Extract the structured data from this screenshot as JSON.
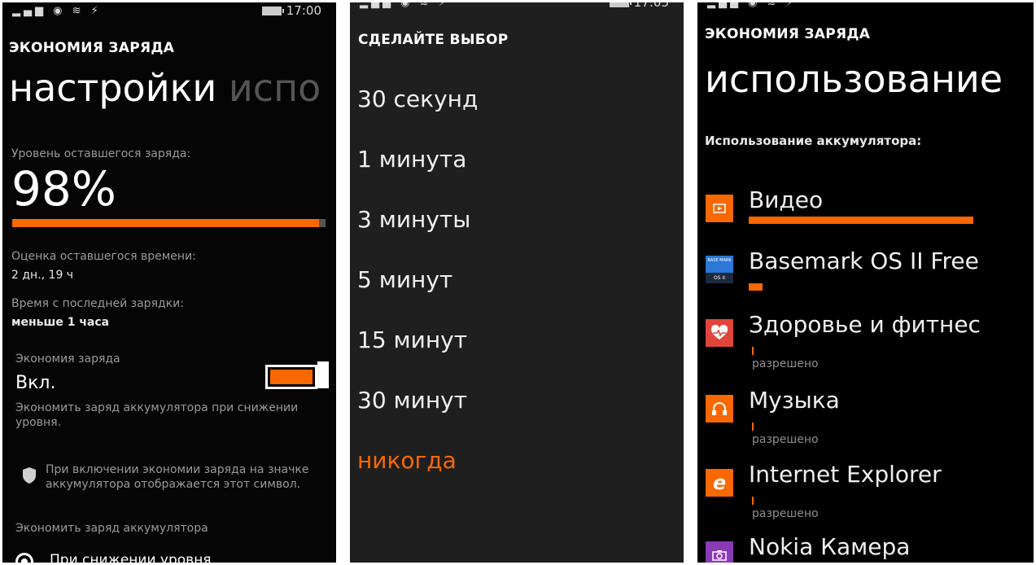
{
  "status_bar": {
    "signal_icon": "signal-bars-icon",
    "time_left": "17:00",
    "time_middle": "17:05"
  },
  "screen_settings": {
    "app_title": "ЭКОНОМИЯ ЗАРЯДА",
    "pivot_active": "настройки",
    "pivot_next": "испо",
    "charge_label": "Уровень оставшегося заряда:",
    "charge_value": "98%",
    "charge_fraction": 0.98,
    "time_estimate_label": "Оценка оставшегося времени:",
    "time_estimate_value": "2 дн., 19 ч",
    "since_charge_label": "Время с последней зарядки:",
    "since_charge_value": "меньше 1 часа",
    "saver_label": "Экономия заряда",
    "saver_state": "Вкл.",
    "saver_description": "Экономить заряд аккумулятора при снижении уровня.",
    "shield_note": "При включении экономии заряда на значке аккумулятора отображается этот символ.",
    "save_when_label": "Экономить заряд аккумулятора",
    "radio_option": "При снижении уровня",
    "accent": "#fa6800"
  },
  "screen_picker": {
    "header": "СДЕЛАЙТЕ ВЫБОР",
    "options": [
      "30 секунд",
      "1 минута",
      "3 минуты",
      "5 минут",
      "15 минут",
      "30 минут",
      "никогда"
    ],
    "selected_index": 6
  },
  "screen_usage": {
    "app_title": "ЭКОНОМИЯ ЗАРЯДА",
    "pivot_active": "использование",
    "usage_label": "Использование аккумулятора:",
    "apps": [
      {
        "name": "Видео",
        "icon": "video-icon",
        "icon_color": "#fa6800",
        "usage": 0.95,
        "status": ""
      },
      {
        "name": "Basemark OS II Free",
        "icon": "basemark-icon",
        "icon_color": "#1e3a6e",
        "usage": 0.06,
        "status": "",
        "icon_text_top": "BASE MARK",
        "icon_text_bottom": "OS II"
      },
      {
        "name": "Здоровье и фитнес",
        "icon": "heart-icon",
        "icon_color": "#e0453c",
        "usage": 0.005,
        "status": "разрешено"
      },
      {
        "name": "Музыка",
        "icon": "headphones-icon",
        "icon_color": "#fa6800",
        "usage": 0.005,
        "status": "разрешено"
      },
      {
        "name": "Internet Explorer",
        "icon": "internet-explorer-icon",
        "icon_color": "#fa6800",
        "usage": 0.005,
        "status": "разрешено"
      },
      {
        "name": "Nokia Камера",
        "icon": "camera-icon",
        "icon_color": "#8b3ab5",
        "usage": 0,
        "status": ""
      }
    ]
  }
}
